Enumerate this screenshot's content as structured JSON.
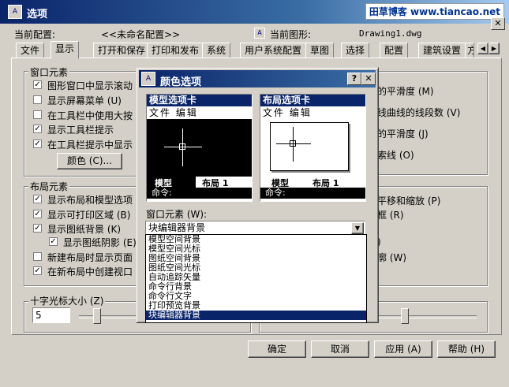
{
  "window": {
    "title": "选项",
    "icon_text": "A",
    "watermark": "田草博客 www.tiancao.net",
    "close_glyph": "✕"
  },
  "profile": {
    "label": "当前配置:",
    "value": "<<未命名配置>>",
    "drawing_label": "当前图形:",
    "drawing_value": "Drawing1.dwg"
  },
  "tabs": [
    "文件",
    "显示",
    "打开和保存",
    "打印和发布",
    "系统",
    "用户系统配置",
    "草图",
    "选择",
    "配置",
    "建筑设置",
    "方"
  ],
  "window_elements": {
    "title": "窗口元素",
    "items": [
      {
        "label": "图形窗口中显示滚动",
        "checked": true
      },
      {
        "label": "显示屏幕菜单 (U)",
        "checked": false
      },
      {
        "label": "在工具栏中使用大按",
        "checked": false
      },
      {
        "label": "显示工具栏提示",
        "checked": true
      },
      {
        "label": "在工具栏提示中显示",
        "checked": true
      }
    ],
    "color_button": "颜色 (C)..."
  },
  "layout_elements": {
    "title": "布局元素",
    "items": [
      {
        "label": "显示布局和模型选项",
        "checked": true
      },
      {
        "label": "显示可打印区域 (B)",
        "checked": true
      },
      {
        "label": "显示图纸背景 (K)",
        "checked": true
      },
      {
        "label": "显示图纸阴影 (E)",
        "checked": true
      },
      {
        "label": "新建布局时显示页面",
        "checked": false
      },
      {
        "label": "在新布局中创建视口",
        "checked": true
      }
    ]
  },
  "right_text": [
    "的平滑度 (M)",
    "线曲线的线段数 (V)",
    "的平滑度 (J)",
    "索线 (O)",
    "平移和缩放 (P)",
    "框 (R)",
    ")",
    "廓 (W)"
  ],
  "crosshair": {
    "label": "十字光标大小 (Z)",
    "value": "5"
  },
  "buttons": {
    "ok": "确定",
    "cancel": "取消",
    "apply": "应用 (A)",
    "help": "帮助 (H)"
  },
  "dialog": {
    "title": "颜色选项",
    "help_glyph": "?",
    "close_glyph": "✕",
    "model_preview": {
      "header": "模型选项卡",
      "menu": "文件 编辑",
      "tab1": "模型",
      "tab2": "布局 1",
      "cmd": "命令:"
    },
    "layout_preview": {
      "header": "布局选项卡",
      "menu": "文件 编辑",
      "tab1": "模型",
      "tab2": "布局 1",
      "cmd": "命令:"
    },
    "element_label": "窗口元素 (W):",
    "selected": "块编辑器背景",
    "options": [
      "模型空间背景",
      "模型空间光标",
      "图纸空间背景",
      "图纸空间光标",
      "自动追踪矢量",
      "命令行背景",
      "命令行文字",
      "打印预览背景",
      "块编辑器背景"
    ]
  }
}
